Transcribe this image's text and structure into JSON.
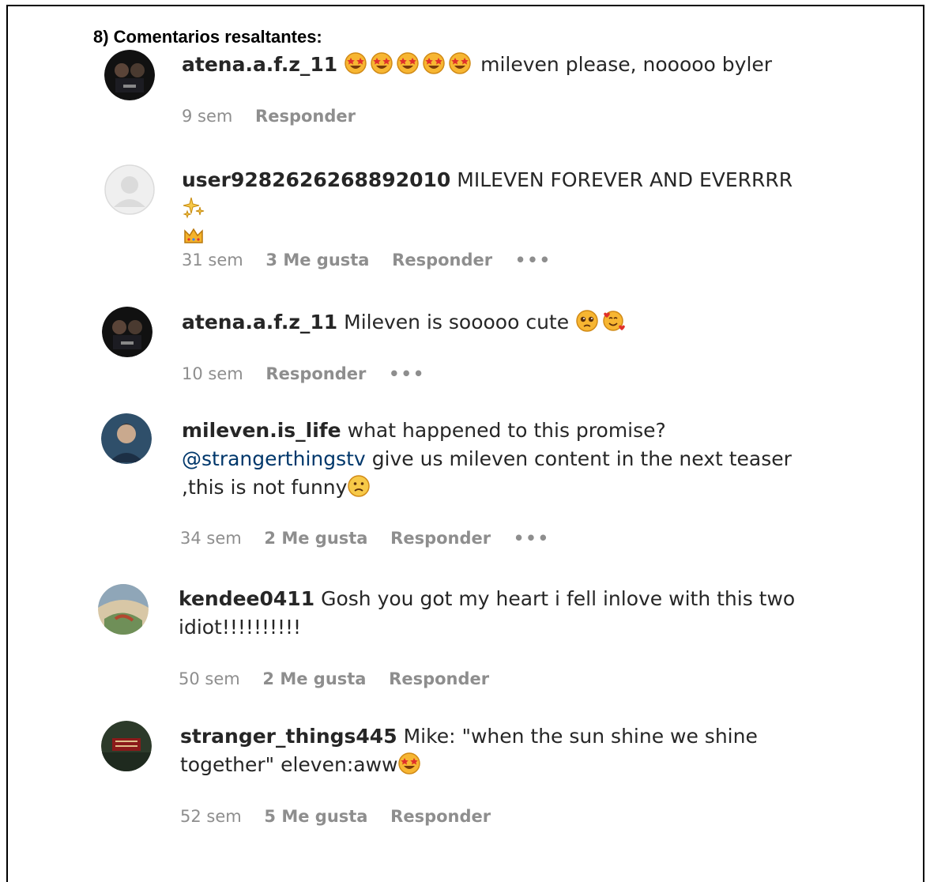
{
  "section": {
    "heading": "8) Comentarios resaltantes:"
  },
  "comments": [
    {
      "username": "atena.a.f.z_11",
      "text": "mileven please, nooooo byler",
      "emoji_before_text": [
        "star-struck-emoji",
        "star-struck-emoji",
        "star-struck-emoji",
        "star-struck-emoji",
        "star-struck-emoji"
      ],
      "time": "9 sem",
      "likes": "",
      "reply": "Responder",
      "more": ""
    },
    {
      "username": "user9282626268892010",
      "text": "MILEVEN FOREVER AND EVERRRR",
      "emoji_after_text": [
        "sparkles-emoji",
        "crown-emoji"
      ],
      "time": "31 sem",
      "likes": "3 Me gusta",
      "reply": "Responder",
      "more": "•••"
    },
    {
      "username": "atena.a.f.z_11",
      "text": "Mileven is sooooo cute",
      "emoji_after_text": [
        "pleading-face-emoji",
        "smiling-hearts-emoji"
      ],
      "time": "10 sem",
      "likes": "",
      "reply": "Responder",
      "more": "•••"
    },
    {
      "username": "mileven.is_life",
      "text_part1": "what happened to this promise?",
      "mention": "@strangerthingstv",
      "text_part2": "give us mileven content in the next teaser ,this is not funny",
      "emoji_after_text": [
        "frowning-face-emoji"
      ],
      "time": "34 sem",
      "likes": "2 Me gusta",
      "reply": "Responder",
      "more": "•••"
    },
    {
      "username": "kendee0411",
      "text": "Gosh you got my heart i fell inlove with this two idiot!!!!!!!!!!",
      "time": "50 sem",
      "likes": "2 Me gusta",
      "reply": "Responder",
      "more": ""
    },
    {
      "username": "stranger_things445",
      "text": "Mike: \"when the sun shine we shine together\" eleven:aww",
      "emoji_after_text": [
        "star-struck-emoji"
      ],
      "time": "52 sem",
      "likes": "5 Me gusta",
      "reply": "Responder",
      "more": ""
    }
  ],
  "colors": {
    "text": "#262626",
    "meta": "#8e8e8e",
    "mention": "#00376b",
    "emoji": "#f5a623"
  }
}
